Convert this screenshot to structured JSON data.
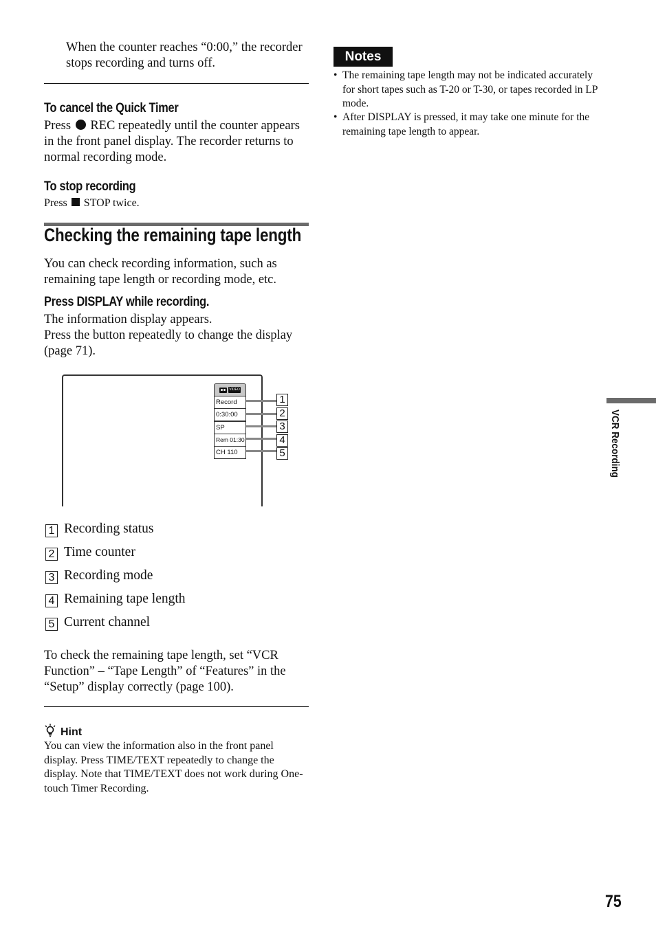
{
  "intro": {
    "text": "When the counter reaches “0:00,” the recorder stops recording and turns off."
  },
  "cancel_quick_timer": {
    "heading": "To cancel the Quick Timer",
    "press": "Press",
    "rec_icon": "record-dot-icon",
    "text": "REC repeatedly until the counter appears in the front panel display. The recorder returns to normal recording mode."
  },
  "stop_recording": {
    "heading": "To stop recording",
    "press": "Press",
    "stop_icon": "stop-square-icon",
    "text": "STOP twice."
  },
  "section": {
    "title": "Checking the remaining tape length",
    "intro": "You can check recording information, such as remaining tape length or recording mode, etc.",
    "step_heading": "Press DISPLAY while recording.",
    "step_line1": "The information display appears.",
    "step_line2": "Press the button repeatedly to change the display (page 71)."
  },
  "diagram": {
    "header_icons": [
      "tape-icon",
      "video-icon"
    ],
    "video_label": "VIDEO",
    "rows": [
      {
        "text": "Record",
        "callout": "1"
      },
      {
        "text": "0:30:00",
        "callout": "2"
      },
      {
        "text": "SP",
        "callout": "3"
      },
      {
        "text": "Rem 01:30",
        "callout": "4"
      },
      {
        "text": "CH 110",
        "callout": "5"
      }
    ]
  },
  "legend": [
    {
      "num": "1",
      "label": "Recording status"
    },
    {
      "num": "2",
      "label": "Time counter"
    },
    {
      "num": "3",
      "label": "Recording mode"
    },
    {
      "num": "4",
      "label": "Remaining tape length"
    },
    {
      "num": "5",
      "label": "Current channel"
    }
  ],
  "setup_note": "To check the remaining tape length, set “VCR Function” – “Tape Length” of “Features” in the “Setup” display correctly (page 100).",
  "hint": {
    "icon": "lightbulb-icon",
    "title": "Hint",
    "text": "You can view the information also in the front panel display. Press TIME/TEXT repeatedly to change the display. Note that TIME/TEXT does not work during One-touch Timer Recording."
  },
  "notes": {
    "title": "Notes",
    "items": [
      "The remaining tape length may not be indicated accurately for short tapes such as T-20 or T-30, or tapes recorded in LP mode.",
      "After DISPLAY is pressed, it may take one minute for the remaining tape length to appear."
    ]
  },
  "side_tab": "VCR Recording",
  "page_number": "75"
}
